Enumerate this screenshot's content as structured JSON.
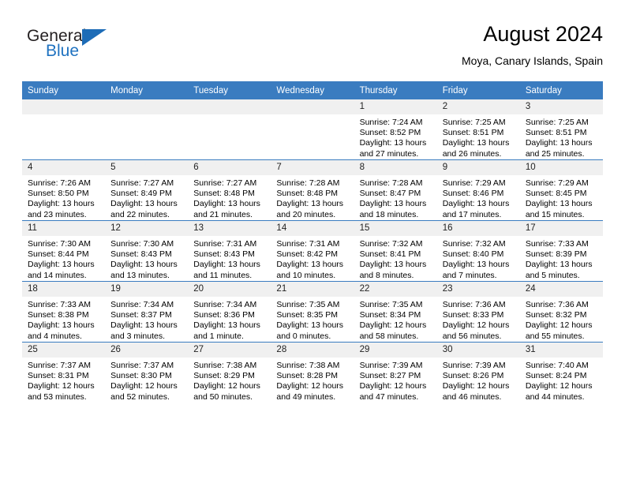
{
  "brand": {
    "name_top": "General",
    "name_bottom": "Blue",
    "flag_icon": "triangle-flag-icon"
  },
  "header": {
    "title": "August 2024",
    "subtitle": "Moya, Canary Islands, Spain"
  },
  "colors": {
    "header_blue": "#3a7cc0",
    "brand_blue": "#1f72c0",
    "daynum_bg": "#f0f0f0"
  },
  "weekdays": [
    "Sunday",
    "Monday",
    "Tuesday",
    "Wednesday",
    "Thursday",
    "Friday",
    "Saturday"
  ],
  "labels": {
    "sunrise_prefix": "Sunrise:",
    "sunset_prefix": "Sunset:",
    "daylight_prefix": "Daylight:"
  },
  "weeks": [
    [
      {
        "day": "",
        "empty": true
      },
      {
        "day": "",
        "empty": true
      },
      {
        "day": "",
        "empty": true
      },
      {
        "day": "",
        "empty": true
      },
      {
        "day": "1",
        "sunrise": "Sunrise: 7:24 AM",
        "sunset": "Sunset: 8:52 PM",
        "daylight": "Daylight: 13 hours and 27 minutes."
      },
      {
        "day": "2",
        "sunrise": "Sunrise: 7:25 AM",
        "sunset": "Sunset: 8:51 PM",
        "daylight": "Daylight: 13 hours and 26 minutes."
      },
      {
        "day": "3",
        "sunrise": "Sunrise: 7:25 AM",
        "sunset": "Sunset: 8:51 PM",
        "daylight": "Daylight: 13 hours and 25 minutes."
      }
    ],
    [
      {
        "day": "4",
        "sunrise": "Sunrise: 7:26 AM",
        "sunset": "Sunset: 8:50 PM",
        "daylight": "Daylight: 13 hours and 23 minutes."
      },
      {
        "day": "5",
        "sunrise": "Sunrise: 7:27 AM",
        "sunset": "Sunset: 8:49 PM",
        "daylight": "Daylight: 13 hours and 22 minutes."
      },
      {
        "day": "6",
        "sunrise": "Sunrise: 7:27 AM",
        "sunset": "Sunset: 8:48 PM",
        "daylight": "Daylight: 13 hours and 21 minutes."
      },
      {
        "day": "7",
        "sunrise": "Sunrise: 7:28 AM",
        "sunset": "Sunset: 8:48 PM",
        "daylight": "Daylight: 13 hours and 20 minutes."
      },
      {
        "day": "8",
        "sunrise": "Sunrise: 7:28 AM",
        "sunset": "Sunset: 8:47 PM",
        "daylight": "Daylight: 13 hours and 18 minutes."
      },
      {
        "day": "9",
        "sunrise": "Sunrise: 7:29 AM",
        "sunset": "Sunset: 8:46 PM",
        "daylight": "Daylight: 13 hours and 17 minutes."
      },
      {
        "day": "10",
        "sunrise": "Sunrise: 7:29 AM",
        "sunset": "Sunset: 8:45 PM",
        "daylight": "Daylight: 13 hours and 15 minutes."
      }
    ],
    [
      {
        "day": "11",
        "sunrise": "Sunrise: 7:30 AM",
        "sunset": "Sunset: 8:44 PM",
        "daylight": "Daylight: 13 hours and 14 minutes."
      },
      {
        "day": "12",
        "sunrise": "Sunrise: 7:30 AM",
        "sunset": "Sunset: 8:43 PM",
        "daylight": "Daylight: 13 hours and 13 minutes."
      },
      {
        "day": "13",
        "sunrise": "Sunrise: 7:31 AM",
        "sunset": "Sunset: 8:43 PM",
        "daylight": "Daylight: 13 hours and 11 minutes."
      },
      {
        "day": "14",
        "sunrise": "Sunrise: 7:31 AM",
        "sunset": "Sunset: 8:42 PM",
        "daylight": "Daylight: 13 hours and 10 minutes."
      },
      {
        "day": "15",
        "sunrise": "Sunrise: 7:32 AM",
        "sunset": "Sunset: 8:41 PM",
        "daylight": "Daylight: 13 hours and 8 minutes."
      },
      {
        "day": "16",
        "sunrise": "Sunrise: 7:32 AM",
        "sunset": "Sunset: 8:40 PM",
        "daylight": "Daylight: 13 hours and 7 minutes."
      },
      {
        "day": "17",
        "sunrise": "Sunrise: 7:33 AM",
        "sunset": "Sunset: 8:39 PM",
        "daylight": "Daylight: 13 hours and 5 minutes."
      }
    ],
    [
      {
        "day": "18",
        "sunrise": "Sunrise: 7:33 AM",
        "sunset": "Sunset: 8:38 PM",
        "daylight": "Daylight: 13 hours and 4 minutes."
      },
      {
        "day": "19",
        "sunrise": "Sunrise: 7:34 AM",
        "sunset": "Sunset: 8:37 PM",
        "daylight": "Daylight: 13 hours and 3 minutes."
      },
      {
        "day": "20",
        "sunrise": "Sunrise: 7:34 AM",
        "sunset": "Sunset: 8:36 PM",
        "daylight": "Daylight: 13 hours and 1 minute."
      },
      {
        "day": "21",
        "sunrise": "Sunrise: 7:35 AM",
        "sunset": "Sunset: 8:35 PM",
        "daylight": "Daylight: 13 hours and 0 minutes."
      },
      {
        "day": "22",
        "sunrise": "Sunrise: 7:35 AM",
        "sunset": "Sunset: 8:34 PM",
        "daylight": "Daylight: 12 hours and 58 minutes."
      },
      {
        "day": "23",
        "sunrise": "Sunrise: 7:36 AM",
        "sunset": "Sunset: 8:33 PM",
        "daylight": "Daylight: 12 hours and 56 minutes."
      },
      {
        "day": "24",
        "sunrise": "Sunrise: 7:36 AM",
        "sunset": "Sunset: 8:32 PM",
        "daylight": "Daylight: 12 hours and 55 minutes."
      }
    ],
    [
      {
        "day": "25",
        "sunrise": "Sunrise: 7:37 AM",
        "sunset": "Sunset: 8:31 PM",
        "daylight": "Daylight: 12 hours and 53 minutes."
      },
      {
        "day": "26",
        "sunrise": "Sunrise: 7:37 AM",
        "sunset": "Sunset: 8:30 PM",
        "daylight": "Daylight: 12 hours and 52 minutes."
      },
      {
        "day": "27",
        "sunrise": "Sunrise: 7:38 AM",
        "sunset": "Sunset: 8:29 PM",
        "daylight": "Daylight: 12 hours and 50 minutes."
      },
      {
        "day": "28",
        "sunrise": "Sunrise: 7:38 AM",
        "sunset": "Sunset: 8:28 PM",
        "daylight": "Daylight: 12 hours and 49 minutes."
      },
      {
        "day": "29",
        "sunrise": "Sunrise: 7:39 AM",
        "sunset": "Sunset: 8:27 PM",
        "daylight": "Daylight: 12 hours and 47 minutes."
      },
      {
        "day": "30",
        "sunrise": "Sunrise: 7:39 AM",
        "sunset": "Sunset: 8:26 PM",
        "daylight": "Daylight: 12 hours and 46 minutes."
      },
      {
        "day": "31",
        "sunrise": "Sunrise: 7:40 AM",
        "sunset": "Sunset: 8:24 PM",
        "daylight": "Daylight: 12 hours and 44 minutes."
      }
    ]
  ]
}
